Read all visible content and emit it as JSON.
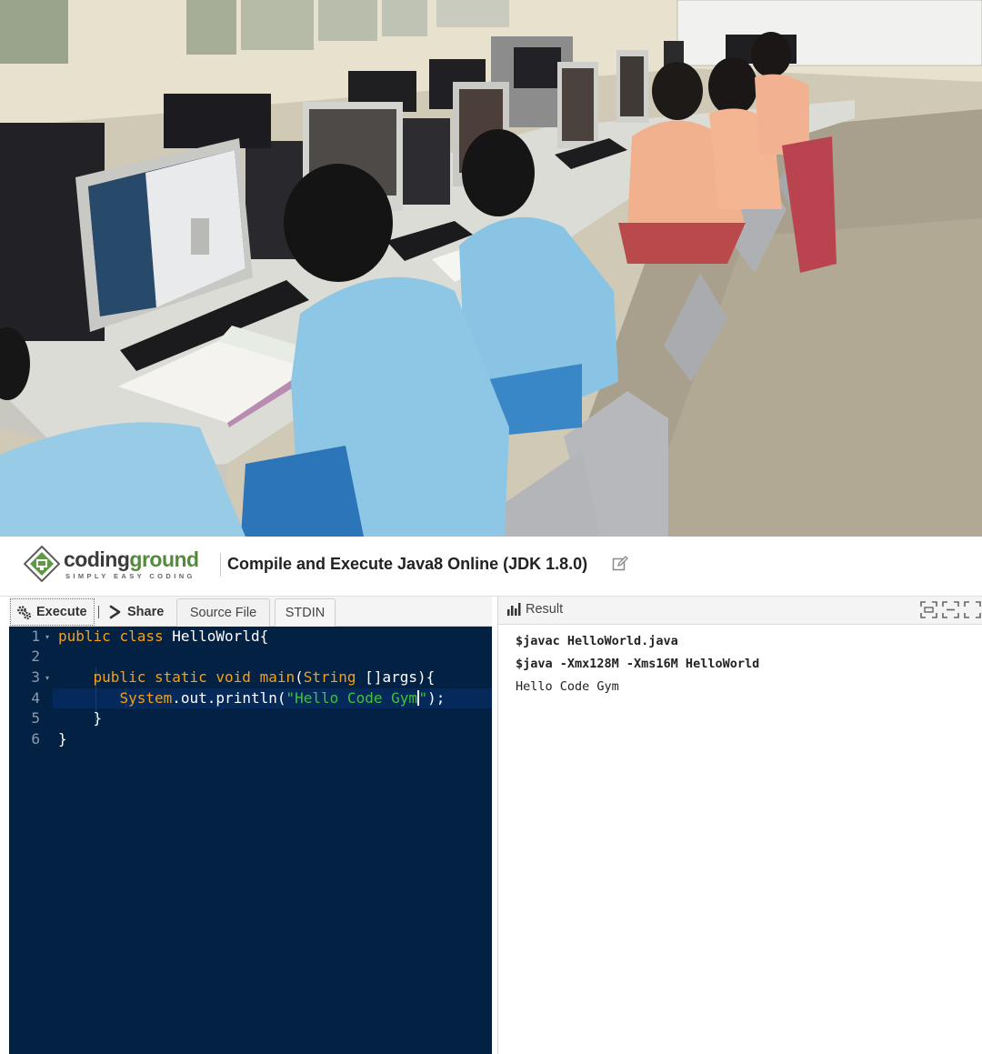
{
  "header": {
    "logo_word_main": "coding",
    "logo_word_accent": "ground",
    "logo_tagline": "SIMPLY EASY CODING",
    "title": "Compile and Execute Java8 Online (JDK 1.8.0)"
  },
  "toolbar": {
    "execute_label": "Execute",
    "share_label": "Share",
    "tabs": [
      {
        "label": "Source File",
        "active": true
      },
      {
        "label": "STDIN",
        "active": false
      }
    ]
  },
  "editor": {
    "active_line": 4,
    "line_numbers": [
      "1",
      "2",
      "3",
      "4",
      "5",
      "6"
    ],
    "lines": [
      "public class HelloWorld{",
      "",
      "    public static void main(String []args){",
      "       System.out.println(\"Hello Code Gym\");",
      "    }",
      "}"
    ]
  },
  "result": {
    "title": "Result",
    "output": [
      {
        "text": "$javac HelloWorld.java",
        "kind": "command"
      },
      {
        "text": "$java -Xmx128M -Xms16M HelloWorld",
        "kind": "command"
      },
      {
        "text": "Hello Code Gym",
        "kind": "stdout"
      }
    ]
  },
  "icons": {
    "execute": "gears-icon",
    "share": "share-icon",
    "edit": "edit-icon",
    "result": "bar-chart-icon",
    "window": [
      "restore-icon",
      "minimize-icon",
      "fullscreen-icon"
    ]
  },
  "colors": {
    "editor_bg": "#022143",
    "keyword": "#f5a017",
    "string": "#3ec43a",
    "brand_green": "#54893e",
    "student_shirt": "#8fc7e6"
  }
}
